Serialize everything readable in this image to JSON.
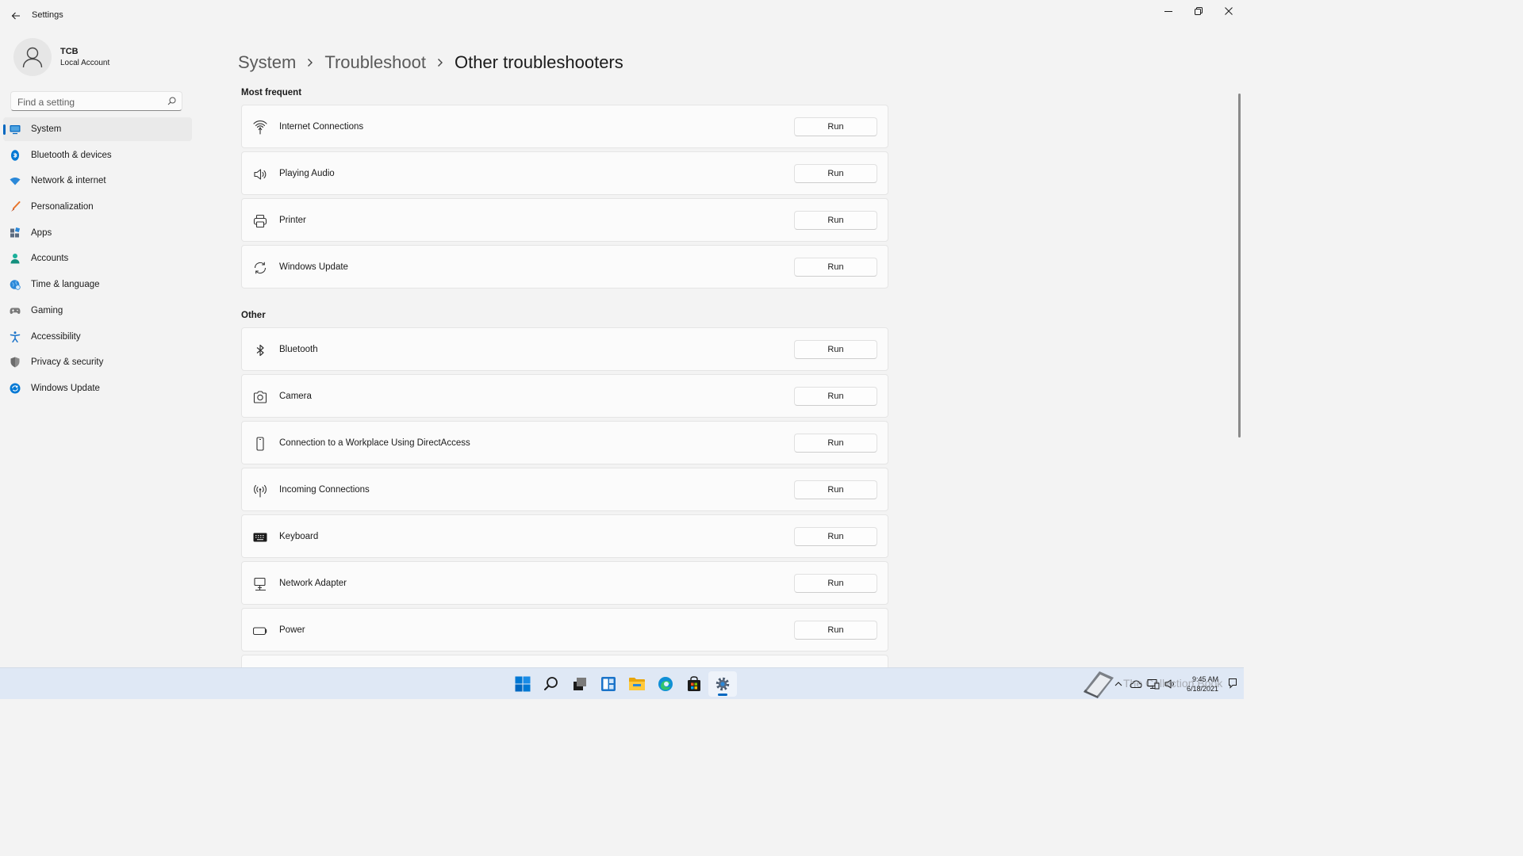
{
  "window": {
    "title": "Settings"
  },
  "user": {
    "name": "TCB",
    "account_type": "Local Account"
  },
  "search": {
    "placeholder": "Find a setting"
  },
  "nav": {
    "items": [
      {
        "label": "System",
        "icon": "system-icon",
        "color": "#0067c0",
        "active": true
      },
      {
        "label": "Bluetooth & devices",
        "icon": "bluetooth-icon",
        "color": "#0078d4"
      },
      {
        "label": "Network & internet",
        "icon": "wifi-icon",
        "color": "#2b88d8"
      },
      {
        "label": "Personalization",
        "icon": "brush-icon",
        "color": "#e8742a"
      },
      {
        "label": "Apps",
        "icon": "apps-icon",
        "color": "#5b6b80"
      },
      {
        "label": "Accounts",
        "icon": "person-icon",
        "color": "#1bb09a"
      },
      {
        "label": "Time & language",
        "icon": "globe-clock-icon",
        "color": "#2b88d8"
      },
      {
        "label": "Gaming",
        "icon": "gamepad-icon",
        "color": "#7a7a7a"
      },
      {
        "label": "Accessibility",
        "icon": "accessibility-icon",
        "color": "#1a73c9"
      },
      {
        "label": "Privacy & security",
        "icon": "shield-icon",
        "color": "#6b6b6b"
      },
      {
        "label": "Windows Update",
        "icon": "update-icon",
        "color": "#0078d4"
      }
    ]
  },
  "breadcrumb": {
    "level1": "System",
    "level2": "Troubleshoot",
    "current": "Other troubleshooters"
  },
  "sections": {
    "most_frequent": {
      "title": "Most frequent",
      "items": [
        {
          "label": "Internet Connections",
          "button": "Run",
          "icon": "signal-icon"
        },
        {
          "label": "Playing Audio",
          "button": "Run",
          "icon": "speaker-icon"
        },
        {
          "label": "Printer",
          "button": "Run",
          "icon": "printer-icon"
        },
        {
          "label": "Windows Update",
          "button": "Run",
          "icon": "sync-icon"
        }
      ]
    },
    "other": {
      "title": "Other",
      "items": [
        {
          "label": "Bluetooth",
          "button": "Run",
          "icon": "bluetooth-icon"
        },
        {
          "label": "Camera",
          "button": "Run",
          "icon": "camera-icon"
        },
        {
          "label": "Connection to a Workplace Using DirectAccess",
          "button": "Run",
          "icon": "phone-device-icon"
        },
        {
          "label": "Incoming Connections",
          "button": "Run",
          "icon": "antenna-icon"
        },
        {
          "label": "Keyboard",
          "button": "Run",
          "icon": "keyboard-icon"
        },
        {
          "label": "Network Adapter",
          "button": "Run",
          "icon": "network-adapter-icon"
        },
        {
          "label": "Power",
          "button": "Run",
          "icon": "battery-icon"
        }
      ]
    }
  },
  "taskbar": {
    "apps": [
      "start-icon",
      "search-icon",
      "task-view-icon",
      "widgets-icon",
      "file-explorer-icon",
      "edge-icon",
      "store-icon",
      "settings-gear-icon"
    ],
    "active_app": "settings-gear-icon",
    "tray": [
      "chevron-up-icon",
      "onedrive-cloud-icon",
      "network-icon",
      "volume-icon"
    ],
    "time": "9:45 AM",
    "date": "6/18/2021",
    "watermark": "The Collection Book"
  },
  "colors": {
    "accent": "#0067c0",
    "background": "#f3f3f3",
    "card": "#fbfbfb",
    "taskbar": "#dfe8f5"
  }
}
